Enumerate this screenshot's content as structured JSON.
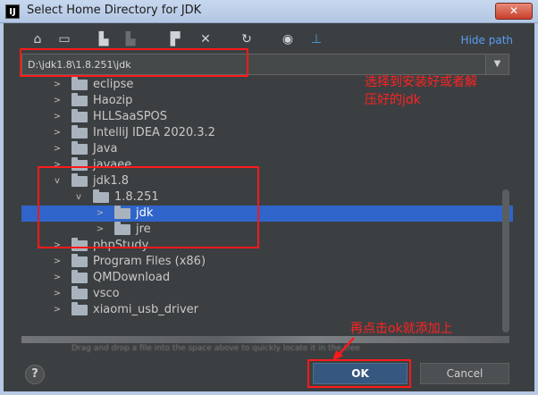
{
  "window": {
    "title": "Select Home Directory for JDK",
    "app_icon_text": "IJ",
    "close_symbol": "✕"
  },
  "toolbar": {
    "icons": [
      "home-icon",
      "desktop-icon",
      "project-icon",
      "module-icon",
      "new-folder-icon",
      "delete-icon",
      "refresh-icon",
      "show-hidden-icon",
      "link-icon"
    ],
    "hide_path_label": "Hide path"
  },
  "path": {
    "value": "D:\\jdk1.8\\1.8.251\\jdk",
    "dropdown_symbol": "▼"
  },
  "tree": {
    "items": [
      {
        "label": "eclipse",
        "arrow": ">",
        "level": 0
      },
      {
        "label": "Haozip",
        "arrow": ">",
        "level": 0
      },
      {
        "label": "HLLSaaSPOS",
        "arrow": ">",
        "level": 0
      },
      {
        "label": "IntelliJ IDEA 2020.3.2",
        "arrow": ">",
        "level": 0
      },
      {
        "label": "Java",
        "arrow": ">",
        "level": 0
      },
      {
        "label": "javaee",
        "arrow": ">",
        "level": 0
      },
      {
        "label": "jdk1.8",
        "arrow": "v",
        "level": 0
      },
      {
        "label": "1.8.251",
        "arrow": "v",
        "level": 1
      },
      {
        "label": "jdk",
        "arrow": ">",
        "level": 2,
        "selected": true
      },
      {
        "label": "jre",
        "arrow": ">",
        "level": 2
      },
      {
        "label": "phpStudy",
        "arrow": ">",
        "level": 0
      },
      {
        "label": "Program Files (x86)",
        "arrow": ">",
        "level": 0
      },
      {
        "label": "QMDownload",
        "arrow": ">",
        "level": 0
      },
      {
        "label": "vsco",
        "arrow": ">",
        "level": 0
      },
      {
        "label": "xiaomi_usb_driver",
        "arrow": ">",
        "level": 0
      }
    ]
  },
  "hint": "Drag and drop a file into the space above to quickly locate it in the tree",
  "buttons": {
    "help": "?",
    "ok": "OK",
    "cancel": "Cancel"
  },
  "annotations": {
    "note_select_line1": "选择到安装好或者解",
    "note_select_line2": "压好的jdk",
    "note_ok": "再点击ok就添加上"
  },
  "colors": {
    "background": "#3c3f41",
    "selection": "#2f65ca",
    "link": "#589df6",
    "annotation": "#ff1a1a"
  }
}
